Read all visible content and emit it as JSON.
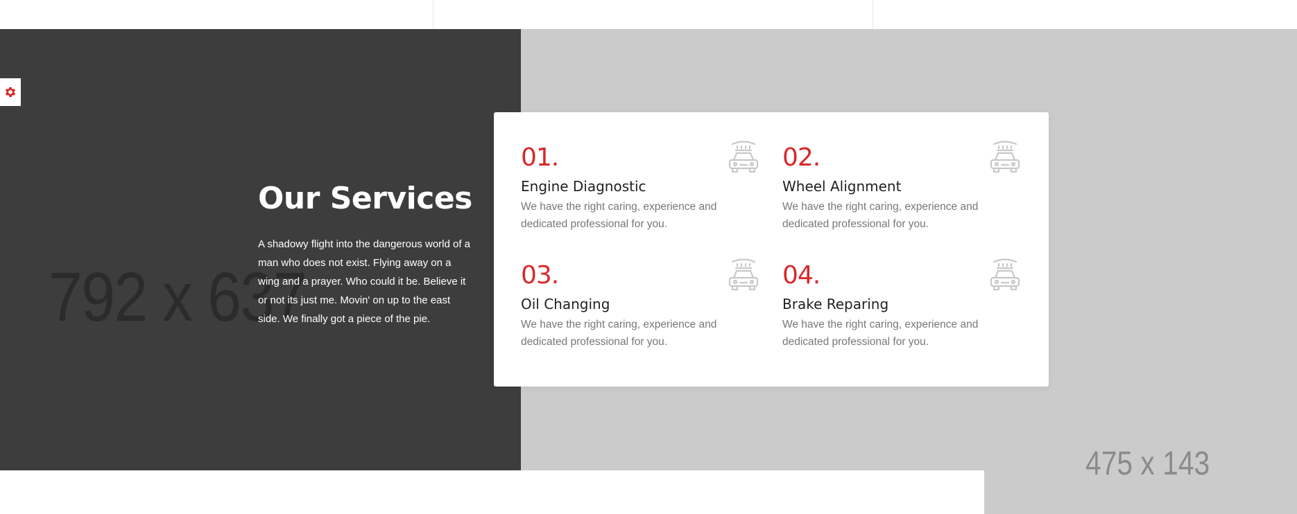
{
  "placeholders": {
    "left_image_label": "792 x 637",
    "bottom_right_image_label": "475 x 143"
  },
  "settings": {
    "icon": "gear-icon",
    "color": "#d8282a"
  },
  "intro": {
    "title": "Our Services",
    "description": "A shadowy flight into the dangerous world of a man who does not exist. Flying away on a wing and a prayer. Who could it be. Believe it or not its just me. Movin' on up to the east side. We finally got a piece of the pie."
  },
  "services": [
    {
      "number": "01.",
      "title": "Engine Diagnostic",
      "description": "We have the right caring, experience and dedicated professional for you.",
      "icon": "car-wash-icon"
    },
    {
      "number": "02.",
      "title": "Wheel Alignment",
      "description": "We have the right caring, experience and dedicated professional for you.",
      "icon": "car-wash-icon"
    },
    {
      "number": "03.",
      "title": "Oil Changing",
      "description": "We have the right caring, experience and dedicated professional for you.",
      "icon": "car-wash-icon"
    },
    {
      "number": "04.",
      "title": "Brake Reparing",
      "description": "We have the right caring, experience and dedicated professional for you.",
      "icon": "car-wash-icon"
    }
  ],
  "colors": {
    "accent": "#d8282a",
    "dark_panel": "#3d3d3d",
    "placeholder_gray": "#cbcbcb",
    "text_muted": "#777777"
  }
}
